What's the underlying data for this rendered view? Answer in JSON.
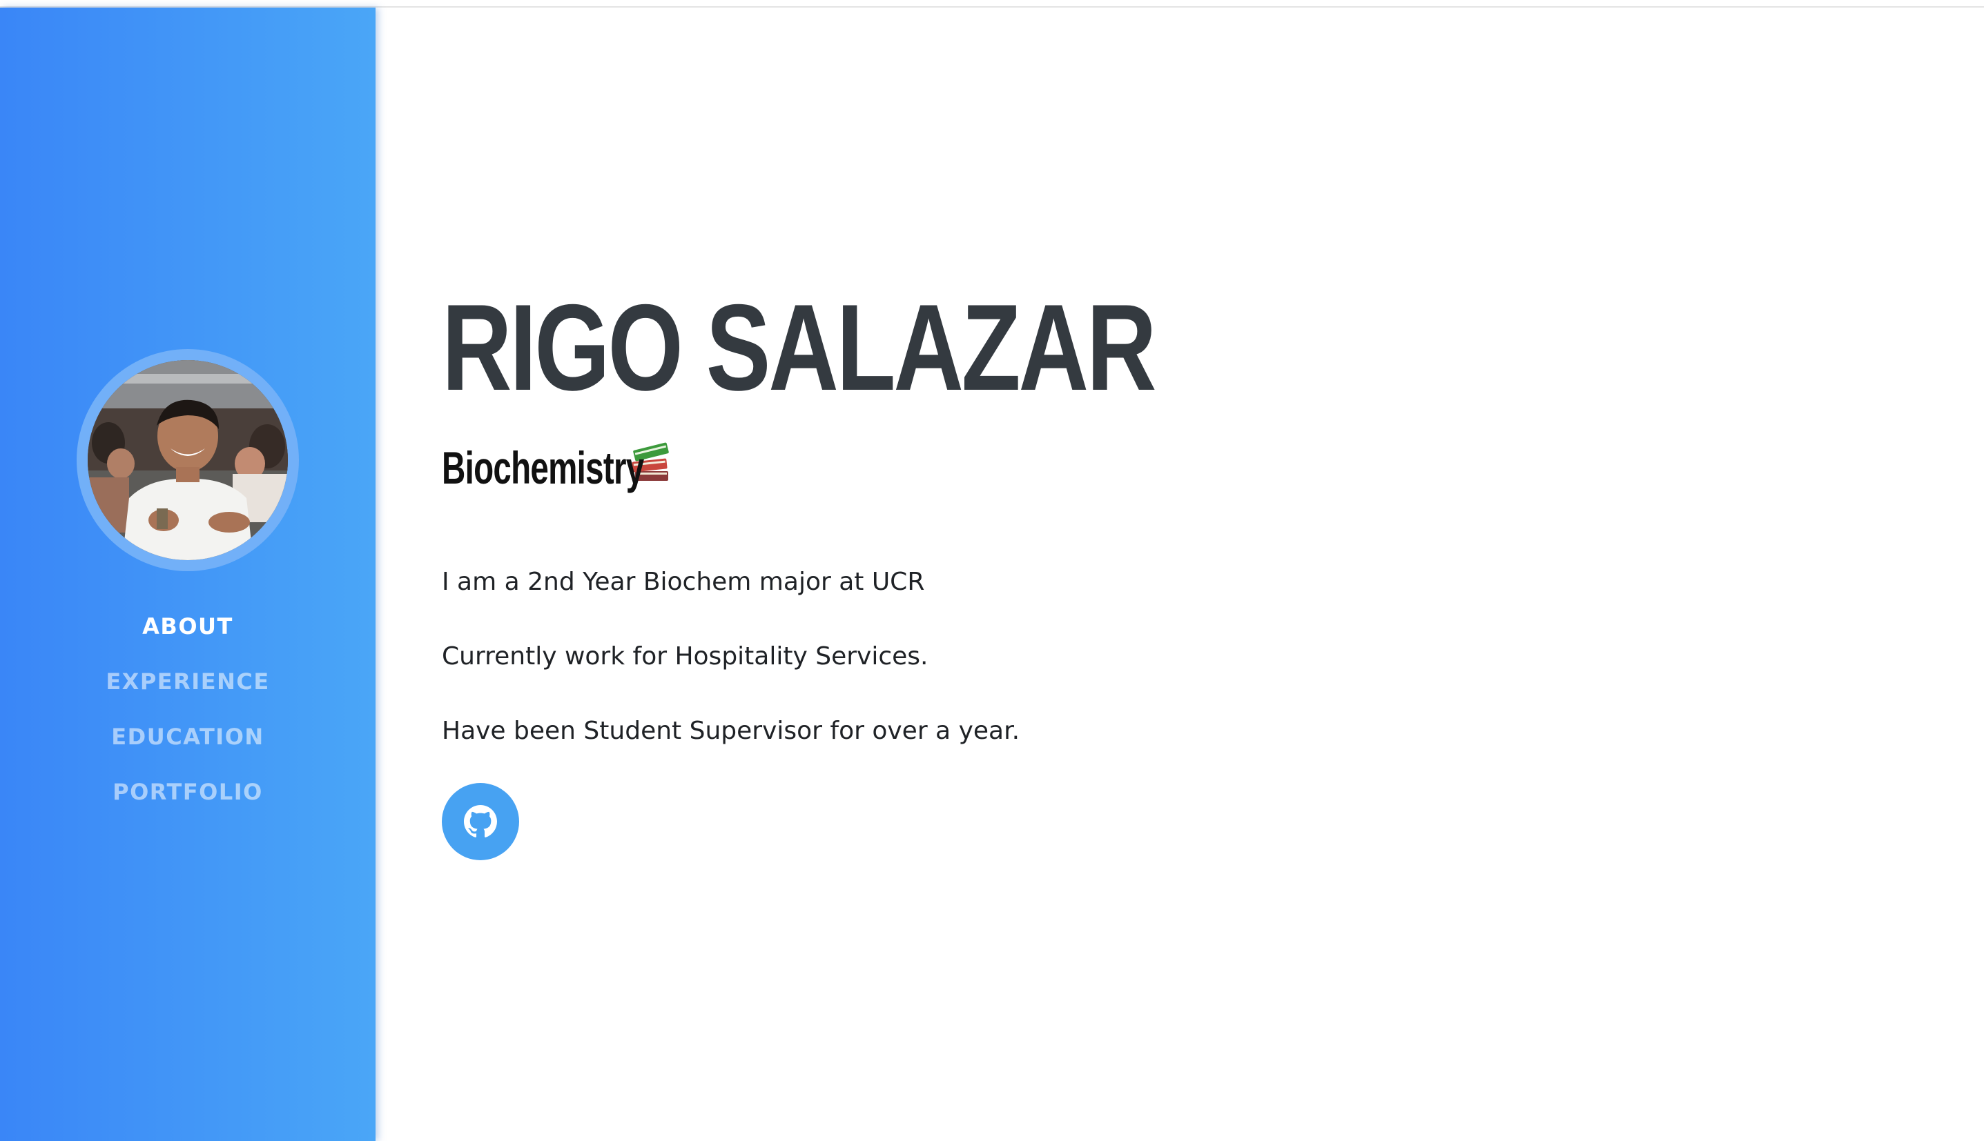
{
  "sidebar": {
    "avatar_alt": "profile photo",
    "nav": [
      {
        "label": "ABOUT",
        "active": true
      },
      {
        "label": "EXPERIENCE",
        "active": false
      },
      {
        "label": "EDUCATION",
        "active": false
      },
      {
        "label": "PORTFOLIO",
        "active": false
      }
    ]
  },
  "main": {
    "name": "RIGO SALAZAR",
    "subtitle": "Biochemistry",
    "subtitle_icon": "books-icon",
    "paragraphs": [
      "I am a 2nd Year Biochem major at UCR",
      "Currently work for Hospitality Services.",
      "Have been Student Supervisor for over a year."
    ],
    "social": {
      "icon": "github-icon"
    }
  },
  "colors": {
    "sidebar_gradient_start": "#3a86f7",
    "sidebar_gradient_end": "#4aa6f7",
    "heading": "#343a40",
    "social_button": "#47a2f2"
  }
}
